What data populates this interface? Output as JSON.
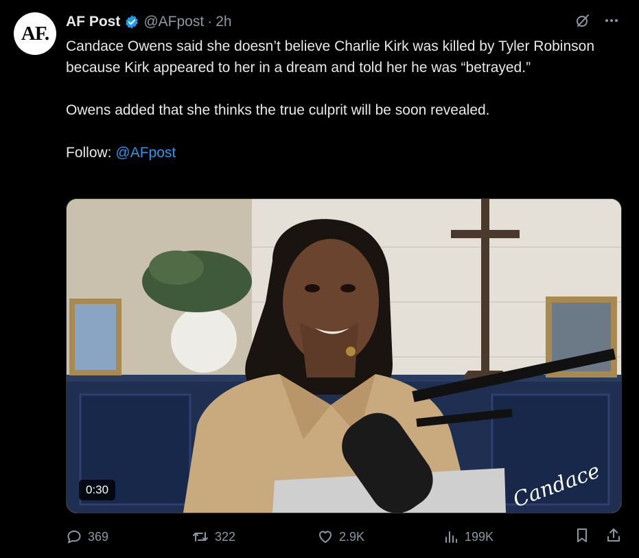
{
  "account": {
    "avatar_text": "AF.",
    "name": "AF Post",
    "handle": "@AFpost",
    "separator": "·",
    "time": "2h"
  },
  "post": {
    "line1": "Candace Owens said she doesn’t believe Charlie Kirk was killed by Tyler Robinson because Kirk appeared to her in a dream and told her he was “betrayed.”",
    "line2": "Owens added that she thinks the true culprit will be soon revealed.",
    "follow_label": "Follow:",
    "follow_link": "@AFpost"
  },
  "media": {
    "duration": "0:30",
    "watermark": "Candace"
  },
  "actions": {
    "replies": "369",
    "reposts": "322",
    "likes": "2.9K",
    "views": "199K"
  },
  "colors": {
    "background": "#000000",
    "text": "#e7e9ea",
    "muted": "#8b98a5",
    "accent": "#1d9bf0"
  },
  "icons": [
    "verified-badge-icon",
    "grok-icon",
    "more-icon",
    "reply-icon",
    "repost-icon",
    "like-icon",
    "views-icon",
    "bookmark-icon",
    "share-icon"
  ]
}
